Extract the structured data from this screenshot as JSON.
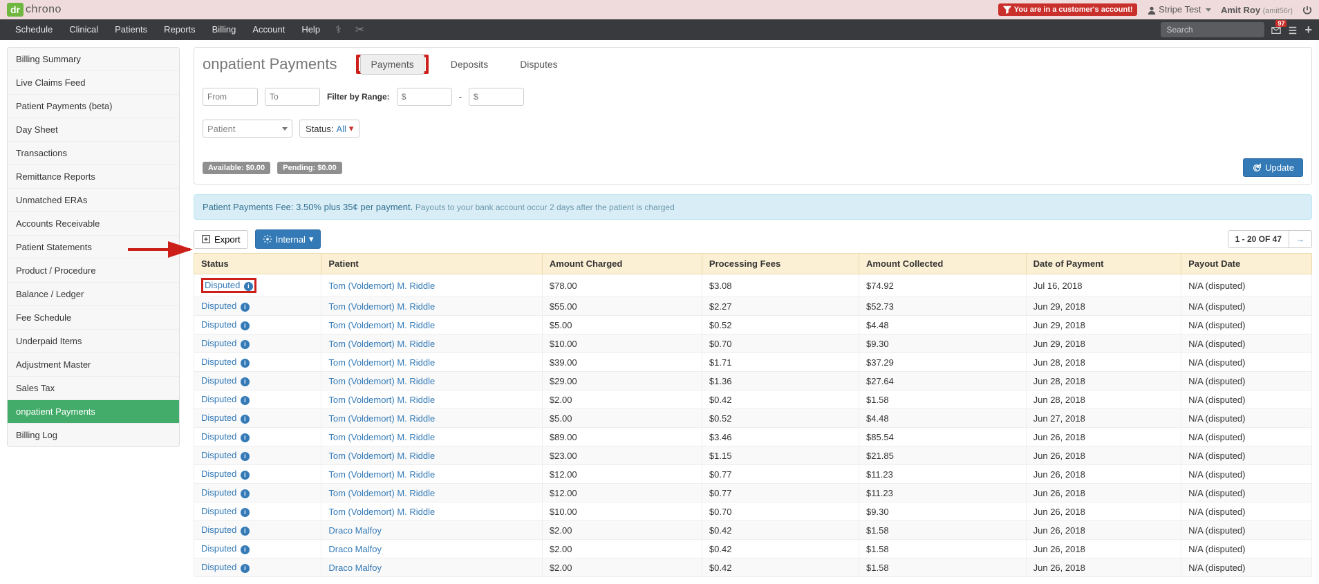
{
  "top": {
    "logo_short": "dr",
    "logo_text": "chrono",
    "customer_badge": "You are in a customer's account!",
    "stripe_user": "Stripe Test",
    "user_name": "Amit Roy",
    "user_handle": "(amit56r)"
  },
  "nav": {
    "items": [
      "Schedule",
      "Clinical",
      "Patients",
      "Reports",
      "Billing",
      "Account",
      "Help"
    ],
    "search_placeholder": "Search",
    "mail_count": "97"
  },
  "sidebar": {
    "items": [
      "Billing Summary",
      "Live Claims Feed",
      "Patient Payments (beta)",
      "Day Sheet",
      "Transactions",
      "Remittance Reports",
      "Unmatched ERAs",
      "Accounts Receivable",
      "Patient Statements",
      "Product / Procedure",
      "Balance / Ledger",
      "Fee Schedule",
      "Underpaid Items",
      "Adjustment Master",
      "Sales Tax",
      "onpatient Payments",
      "Billing Log"
    ],
    "active_index": 15
  },
  "page": {
    "title": "onpatient Payments",
    "tabs": {
      "payments": "Payments",
      "deposits": "Deposits",
      "disputes": "Disputes"
    },
    "filters": {
      "from_ph": "From",
      "to_ph": "To",
      "range_label": "Filter by Range:",
      "dollar_ph": "$",
      "patient_ph": "Patient",
      "status_label": "Status:",
      "status_value": "All",
      "available": "Available: $0.00",
      "pending": "Pending: $0.00",
      "update": "Update"
    },
    "banner": {
      "bold": "Patient Payments Fee: 3.50% plus 35¢ per payment.",
      "small": "Payouts to your bank account occur 2 days after the patient is charged"
    },
    "toolbar": {
      "export": "Export",
      "internal": "Internal",
      "pagination_text": "1 - 20 OF 47"
    },
    "columns": [
      "Status",
      "Patient",
      "Amount Charged",
      "Processing Fees",
      "Amount Collected",
      "Date of Payment",
      "Payout Date"
    ],
    "rows": [
      {
        "status": "Disputed",
        "patient": "Tom (Voldemort) M. Riddle",
        "charged": "$78.00",
        "fees": "$3.08",
        "collected": "$74.92",
        "date": "Jul 16, 2018",
        "payout": "N/A (disputed)",
        "highlight": true
      },
      {
        "status": "Disputed",
        "patient": "Tom (Voldemort) M. Riddle",
        "charged": "$55.00",
        "fees": "$2.27",
        "collected": "$52.73",
        "date": "Jun 29, 2018",
        "payout": "N/A (disputed)"
      },
      {
        "status": "Disputed",
        "patient": "Tom (Voldemort) M. Riddle",
        "charged": "$5.00",
        "fees": "$0.52",
        "collected": "$4.48",
        "date": "Jun 29, 2018",
        "payout": "N/A (disputed)"
      },
      {
        "status": "Disputed",
        "patient": "Tom (Voldemort) M. Riddle",
        "charged": "$10.00",
        "fees": "$0.70",
        "collected": "$9.30",
        "date": "Jun 29, 2018",
        "payout": "N/A (disputed)"
      },
      {
        "status": "Disputed",
        "patient": "Tom (Voldemort) M. Riddle",
        "charged": "$39.00",
        "fees": "$1.71",
        "collected": "$37.29",
        "date": "Jun 28, 2018",
        "payout": "N/A (disputed)"
      },
      {
        "status": "Disputed",
        "patient": "Tom (Voldemort) M. Riddle",
        "charged": "$29.00",
        "fees": "$1.36",
        "collected": "$27.64",
        "date": "Jun 28, 2018",
        "payout": "N/A (disputed)"
      },
      {
        "status": "Disputed",
        "patient": "Tom (Voldemort) M. Riddle",
        "charged": "$2.00",
        "fees": "$0.42",
        "collected": "$1.58",
        "date": "Jun 28, 2018",
        "payout": "N/A (disputed)"
      },
      {
        "status": "Disputed",
        "patient": "Tom (Voldemort) M. Riddle",
        "charged": "$5.00",
        "fees": "$0.52",
        "collected": "$4.48",
        "date": "Jun 27, 2018",
        "payout": "N/A (disputed)"
      },
      {
        "status": "Disputed",
        "patient": "Tom (Voldemort) M. Riddle",
        "charged": "$89.00",
        "fees": "$3.46",
        "collected": "$85.54",
        "date": "Jun 26, 2018",
        "payout": "N/A (disputed)"
      },
      {
        "status": "Disputed",
        "patient": "Tom (Voldemort) M. Riddle",
        "charged": "$23.00",
        "fees": "$1.15",
        "collected": "$21.85",
        "date": "Jun 26, 2018",
        "payout": "N/A (disputed)"
      },
      {
        "status": "Disputed",
        "patient": "Tom (Voldemort) M. Riddle",
        "charged": "$12.00",
        "fees": "$0.77",
        "collected": "$11.23",
        "date": "Jun 26, 2018",
        "payout": "N/A (disputed)"
      },
      {
        "status": "Disputed",
        "patient": "Tom (Voldemort) M. Riddle",
        "charged": "$12.00",
        "fees": "$0.77",
        "collected": "$11.23",
        "date": "Jun 26, 2018",
        "payout": "N/A (disputed)"
      },
      {
        "status": "Disputed",
        "patient": "Tom (Voldemort) M. Riddle",
        "charged": "$10.00",
        "fees": "$0.70",
        "collected": "$9.30",
        "date": "Jun 26, 2018",
        "payout": "N/A (disputed)"
      },
      {
        "status": "Disputed",
        "patient": "Draco Malfoy",
        "charged": "$2.00",
        "fees": "$0.42",
        "collected": "$1.58",
        "date": "Jun 26, 2018",
        "payout": "N/A (disputed)"
      },
      {
        "status": "Disputed",
        "patient": "Draco Malfoy",
        "charged": "$2.00",
        "fees": "$0.42",
        "collected": "$1.58",
        "date": "Jun 26, 2018",
        "payout": "N/A (disputed)"
      },
      {
        "status": "Disputed",
        "patient": "Draco Malfoy",
        "charged": "$2.00",
        "fees": "$0.42",
        "collected": "$1.58",
        "date": "Jun 26, 2018",
        "payout": "N/A (disputed)"
      }
    ]
  }
}
